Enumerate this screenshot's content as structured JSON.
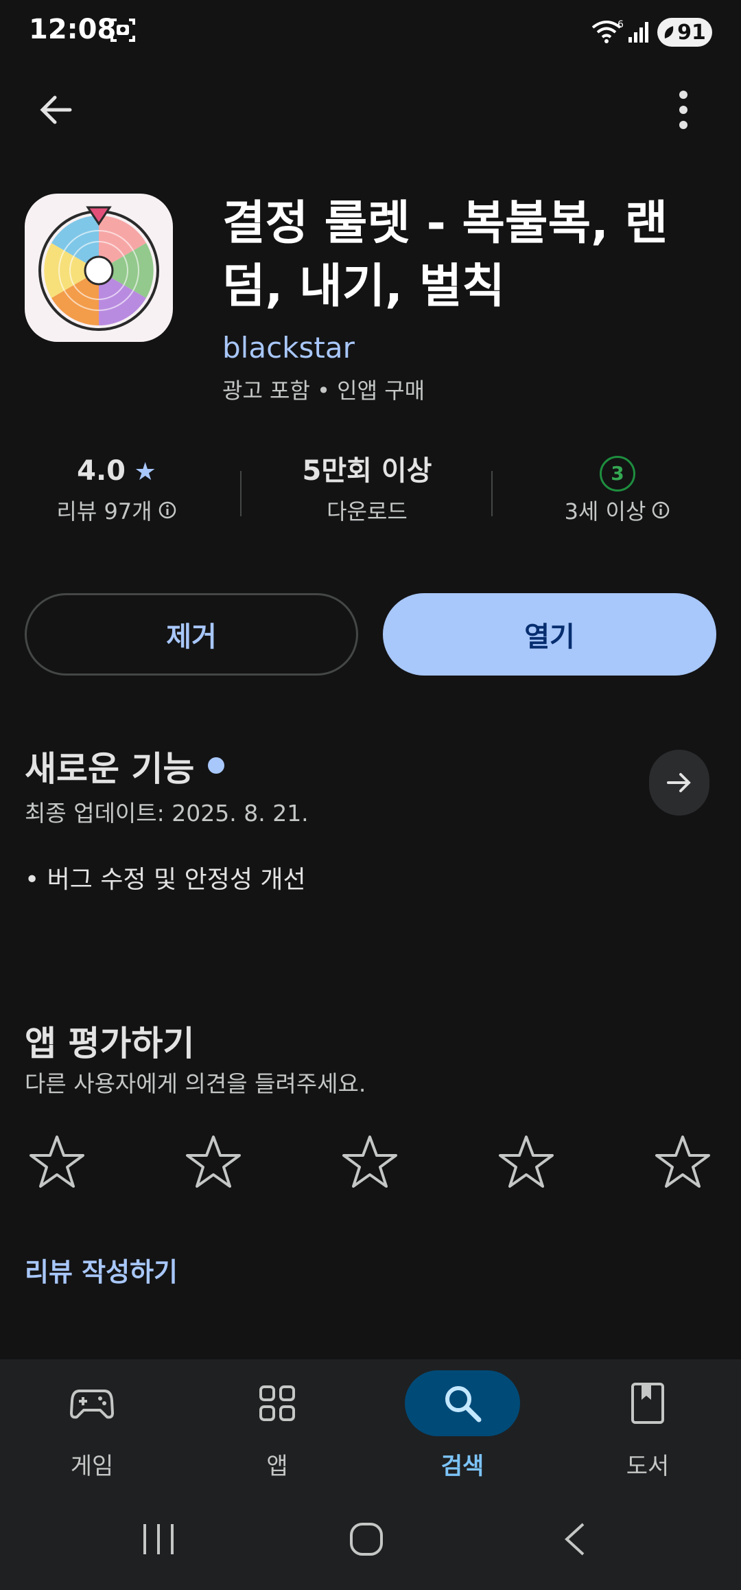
{
  "status_bar": {
    "time": "12:08",
    "battery": "91"
  },
  "app": {
    "title": "결정 룰렛 - 복불복, 랜덤, 내기, 벌칙",
    "developer": "blackstar",
    "tags": "광고 포함 • 인앱 구매"
  },
  "stats": {
    "rating": "4.0",
    "reviews": "리뷰 97개",
    "downloads": "5만회 이상",
    "downloads_label": "다운로드",
    "age_badge": "3",
    "age_label": "3세 이상"
  },
  "actions": {
    "remove": "제거",
    "open": "열기"
  },
  "whats_new": {
    "title": "새로운 기능",
    "updated": "최종 업데이트: 2025. 8. 21.",
    "notes": "• 버그 수정 및 안정성 개선"
  },
  "rate": {
    "title": "앱 평가하기",
    "subtitle": "다른 사용자에게 의견을 들려주세요.",
    "stars": 5,
    "write_review": "리뷰 작성하기"
  },
  "bottom_nav": [
    {
      "label": "게임",
      "icon": "gamepad-icon",
      "active": false
    },
    {
      "label": "앱",
      "icon": "apps-grid-icon",
      "active": false
    },
    {
      "label": "검색",
      "icon": "search-icon",
      "active": true
    },
    {
      "label": "도서",
      "icon": "book-icon",
      "active": false
    }
  ],
  "colors": {
    "background": "#131314",
    "accent": "#a8c7fa",
    "age_green": "#34a853",
    "active_nav": "#004a77"
  }
}
